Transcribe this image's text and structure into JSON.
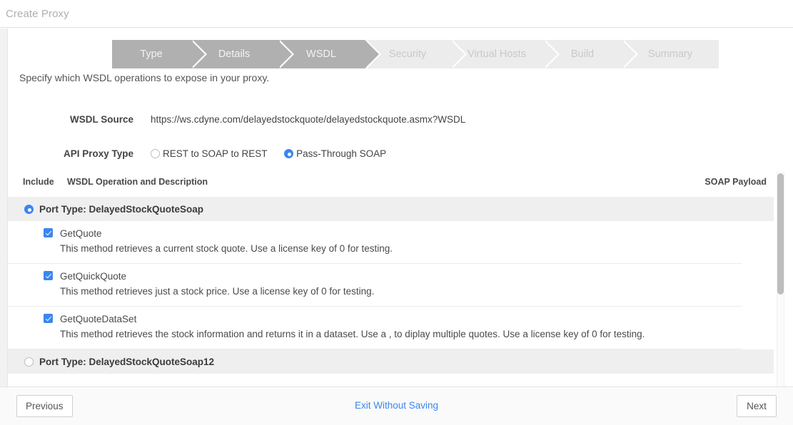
{
  "window": {
    "title": "Create Proxy"
  },
  "colors": {
    "accent": "#3b86f0",
    "step_active": "#b0b0b0",
    "step_future": "#ececec",
    "link": "#3b86f0",
    "row_header_bg": "#efefef"
  },
  "wizard": {
    "steps": [
      {
        "label": "Type",
        "state": "done"
      },
      {
        "label": "Details",
        "state": "done"
      },
      {
        "label": "WSDL",
        "state": "current"
      },
      {
        "label": "Security",
        "state": "future"
      },
      {
        "label": "Virtual Hosts",
        "state": "future"
      },
      {
        "label": "Build",
        "state": "future"
      },
      {
        "label": "Summary",
        "state": "future"
      }
    ]
  },
  "page": {
    "subtitle": "Specify which WSDL operations to expose in your proxy."
  },
  "form": {
    "wsdl_source": {
      "label": "WSDL Source",
      "value": "https://ws.cdyne.com/delayedstockquote/delayedstockquote.asmx?WSDL"
    },
    "api_proxy_type": {
      "label": "API Proxy Type",
      "options": [
        {
          "label": "REST to SOAP to REST",
          "selected": false
        },
        {
          "label": "Pass-Through SOAP",
          "selected": true
        }
      ]
    }
  },
  "table": {
    "headers": {
      "include": "Include",
      "operation": "WSDL Operation and Description",
      "payload": "SOAP Payload"
    },
    "port_types": [
      {
        "label": "Port Type: DelayedStockQuoteSoap",
        "selected": true,
        "operations": [
          {
            "name": "GetQuote",
            "checked": true,
            "description": "This method retrieves a current stock quote. Use a license key of 0 for testing."
          },
          {
            "name": "GetQuickQuote",
            "checked": true,
            "description": "This method retrieves just a stock price. Use a license key of 0 for testing."
          },
          {
            "name": "GetQuoteDataSet",
            "checked": true,
            "description": "This method retrieves the stock information and returns it in a dataset. Use a , to diplay multiple quotes. Use a license key of 0 for testing."
          }
        ]
      },
      {
        "label": "Port Type: DelayedStockQuoteSoap12",
        "selected": false,
        "operations": []
      }
    ]
  },
  "footer": {
    "previous": "Previous",
    "exit": "Exit Without Saving",
    "next": "Next"
  }
}
